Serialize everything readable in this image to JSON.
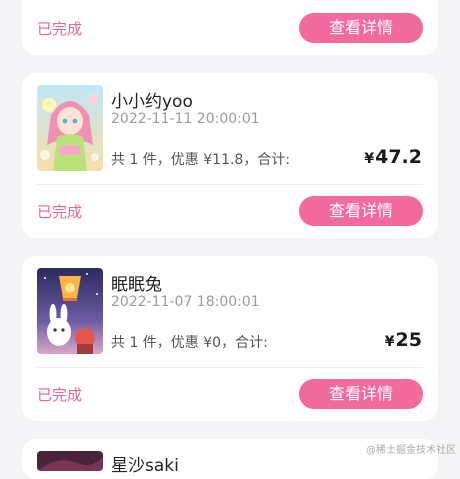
{
  "orders": [
    {
      "status": "已完成",
      "detail_button": "查看详情"
    },
    {
      "name": "小小约yoo",
      "time": "2022-11-11 20:00:01",
      "summary": "共 1 件，优惠 ¥11.8，合计:",
      "currency": "¥",
      "total": "47.2",
      "status": "已完成",
      "detail_button": "查看详情",
      "thumbnail": "anime-girl-pink-hair-image"
    },
    {
      "name": "眠眠兔",
      "time": "2022-11-07 18:00:01",
      "summary": "共 1 件，优惠 ¥0，合计:",
      "currency": "¥",
      "total": "25",
      "status": "已完成",
      "detail_button": "查看详情",
      "thumbnail": "bunny-lantern-night-image"
    },
    {
      "name": "星沙saki",
      "thumbnail": "dark-anime-image"
    }
  ],
  "watermark": "@稀土掘金技术社区",
  "colors": {
    "accent": "#f26b9c",
    "status": "#e8639a",
    "background": "#f4f4f6"
  }
}
